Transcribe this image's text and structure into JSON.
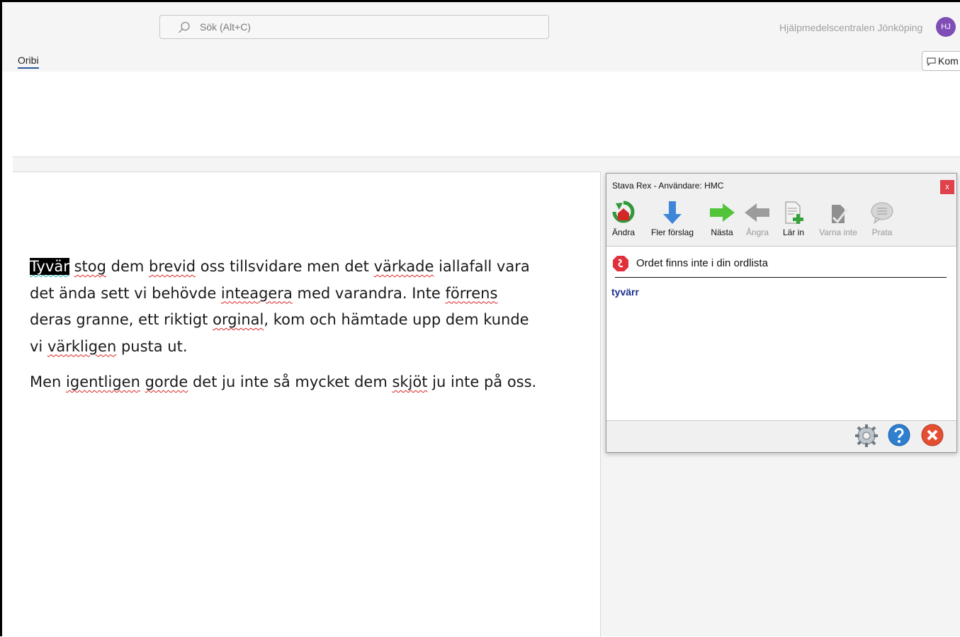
{
  "header": {
    "search_placeholder": "Sök (Alt+C)",
    "organization": "Hjälpmedelscentralen Jönköping",
    "avatar_initials": "HJ",
    "tab_label": "Oribi",
    "comments_button": "Kom",
    "colors": {
      "avatar_bg": "#7e4db6",
      "tab_underline": "#2b579a"
    }
  },
  "document": {
    "paragraphs": [
      [
        {
          "t": "Tyvär",
          "s": "hl"
        },
        {
          "t": " "
        },
        {
          "t": "stog",
          "s": "sq"
        },
        {
          "t": " dem "
        },
        {
          "t": "brevid",
          "s": "sq"
        },
        {
          "t": " oss tillsvidare men det "
        },
        {
          "t": "värkade",
          "s": "sq"
        },
        {
          "t": " iallafall vara det ända sett vi behövde "
        },
        {
          "t": "inteagera",
          "s": "sq"
        },
        {
          "t": " med varandra. Inte "
        },
        {
          "t": "förrens",
          "s": "sq"
        },
        {
          "t": " deras granne, ett riktigt "
        },
        {
          "t": "orginal",
          "s": "sq"
        },
        {
          "t": ", kom och hämtade upp dem kunde vi "
        },
        {
          "t": "värkligen",
          "s": "sq"
        },
        {
          "t": " pusta ut."
        }
      ],
      [
        {
          "t": "Men "
        },
        {
          "t": "igentligen",
          "s": "sq"
        },
        {
          "t": " "
        },
        {
          "t": "gorde",
          "s": "sq"
        },
        {
          "t": " det ju inte så mycket dem "
        },
        {
          "t": "skjöt",
          "s": "sq"
        },
        {
          "t": " ju inte på oss."
        }
      ]
    ],
    "colors": {
      "misspelling_underline": "#dd2222",
      "highlight_bg": "#000000"
    }
  },
  "stava_rex": {
    "title": "Stava Rex - Användare: HMC",
    "close_glyph": "x",
    "toolbar": [
      {
        "label": "Ändra",
        "icon": "change-icon",
        "enabled": true
      },
      {
        "label": "Fler förslag",
        "icon": "more-suggestions-icon",
        "enabled": true
      },
      {
        "label": "Nästa",
        "icon": "next-icon",
        "enabled": true
      },
      {
        "label": "Ångra",
        "icon": "undo-icon",
        "enabled": false
      },
      {
        "label": "Lär in",
        "icon": "learn-icon",
        "enabled": true
      },
      {
        "label": "Varna inte",
        "icon": "no-warn-icon",
        "enabled": false
      },
      {
        "label": "Prata",
        "icon": "speak-icon",
        "enabled": false
      }
    ],
    "message": "Ordet finns inte i din ordlista",
    "suggestions": [
      "tyvärr"
    ],
    "bottom_icons": [
      "settings-icon",
      "help-icon",
      "close-circle-icon"
    ],
    "colors": {
      "suggestion": "#1a2f8f",
      "close_bg": "#e0424b"
    }
  }
}
